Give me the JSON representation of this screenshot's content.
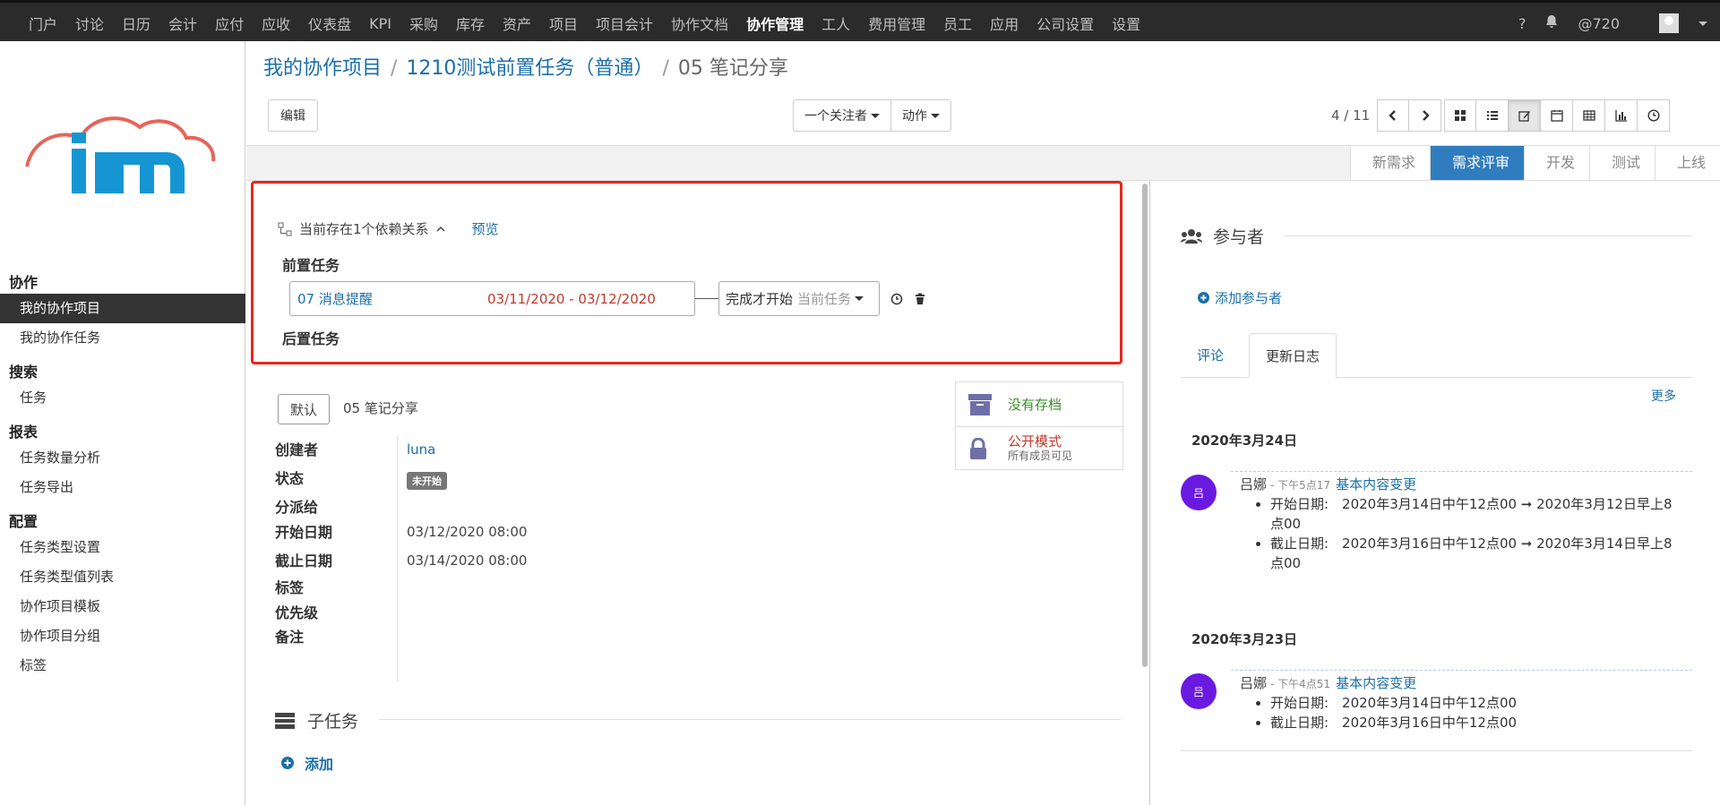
{
  "topnav": {
    "items": [
      "门户",
      "讨论",
      "日历",
      "会计",
      "应付",
      "应收",
      "仪表盘",
      "KPI",
      "采购",
      "库存",
      "资产",
      "项目",
      "项目会计",
      "协作文档",
      "协作管理",
      "工人",
      "费用管理",
      "员工",
      "应用",
      "公司设置",
      "设置"
    ],
    "active_index": 14,
    "help": "?",
    "mentions": "@720"
  },
  "sidebar": {
    "groups": [
      {
        "title": "协作",
        "items": [
          "我的协作项目",
          "我的协作任务"
        ]
      },
      {
        "title": "搜索",
        "items": [
          "任务"
        ]
      },
      {
        "title": "报表",
        "items": [
          "任务数量分析",
          "任务导出"
        ]
      },
      {
        "title": "配置",
        "items": [
          "任务类型设置",
          "任务类型值列表",
          "协作项目模板",
          "协作项目分组",
          "标签"
        ]
      }
    ],
    "active_item": "我的协作项目"
  },
  "breadcrumb": {
    "items": [
      "我的协作项目",
      "1210测试前置任务（普通）"
    ],
    "current": "05 笔记分享"
  },
  "toolbar": {
    "edit_label": "编辑",
    "follower_label": "一个关注者",
    "action_label": "动作",
    "pager": "4 / 11"
  },
  "stages": {
    "items": [
      "新需求",
      "需求评审",
      "开发",
      "测试",
      "上线"
    ],
    "active_index": 1
  },
  "dependency": {
    "summary": "当前存在1个依赖关系",
    "preview": "预览",
    "pre_title": "前置任务",
    "post_title": "后置任务",
    "task_name": "07 消息提醒",
    "task_dates": "03/11/2020 - 03/12/2020",
    "relation": "完成才开始",
    "relation_target": "当前任务"
  },
  "form": {
    "default_tag": "默认",
    "name": "05 笔记分享",
    "archive_text": "没有存档",
    "privacy_title": "公开模式",
    "privacy_sub": "所有成员可见",
    "labels": {
      "creator": "创建者",
      "state": "状态",
      "assignee": "分派给",
      "start": "开始日期",
      "deadline": "截止日期",
      "tags": "标签",
      "priority": "优先级",
      "notes": "备注"
    },
    "values": {
      "creator": "luna",
      "state": "未开始",
      "start": "03/12/2020 08:00",
      "deadline": "03/14/2020 08:00"
    },
    "subtask_title": "子任务",
    "add_label": "添加"
  },
  "chatter": {
    "participants_title": "参与者",
    "add_participant": "添加参与者",
    "tabs": [
      "评论",
      "更新日志"
    ],
    "more": "更多",
    "days": [
      {
        "date": "2020年3月24日",
        "author": "吕娜",
        "avatar_char": "吕",
        "time": "- 下午5点17",
        "kind": "基本内容变更",
        "lines": [
          "开始日期:　2020年3月14日中午12点00 ➞ 2020年3月12日早上8点00",
          "截止日期:　2020年3月16日中午12点00 ➞ 2020年3月14日早上8点00"
        ]
      },
      {
        "date": "2020年3月23日",
        "author": "吕娜",
        "avatar_char": "吕",
        "time": "- 下午4点51",
        "kind": "基本内容变更",
        "lines": [
          "开始日期:　2020年3月14日中午12点00",
          "截止日期:　2020年3月16日中午12点00"
        ]
      }
    ]
  }
}
